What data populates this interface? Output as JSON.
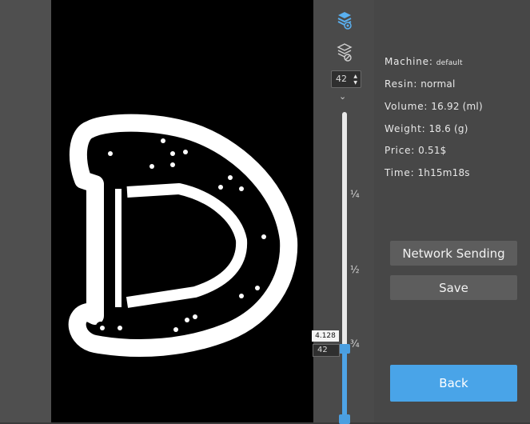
{
  "layer_controls": {
    "show_all_icon": "layers-eye-icon",
    "hide_icon": "layers-hidden-icon",
    "top_layer_value": "42",
    "scroll_icon": "chevron-down-icon"
  },
  "slider": {
    "ticks": [
      "¼",
      "½",
      "¾"
    ],
    "current_layer": "42",
    "current_height": "4.128",
    "position_fraction": 0.0,
    "accent": "#4ea3e6"
  },
  "info": {
    "machine_label": "Machine:",
    "machine_value": "default",
    "resin_label": "Resin:",
    "resin_value": "normal",
    "volume_label": "Volume:",
    "volume_value": "16.92 (ml)",
    "weight_label": "Weight:",
    "weight_value": "18.6 (g)",
    "price_label": "Price:",
    "price_value": "0.51$",
    "time_label": "Time:",
    "time_value": "1h15m18s"
  },
  "buttons": {
    "network_sending": "Network Sending",
    "save": "Save",
    "back": "Back",
    "back_color": "#49a4e8"
  }
}
